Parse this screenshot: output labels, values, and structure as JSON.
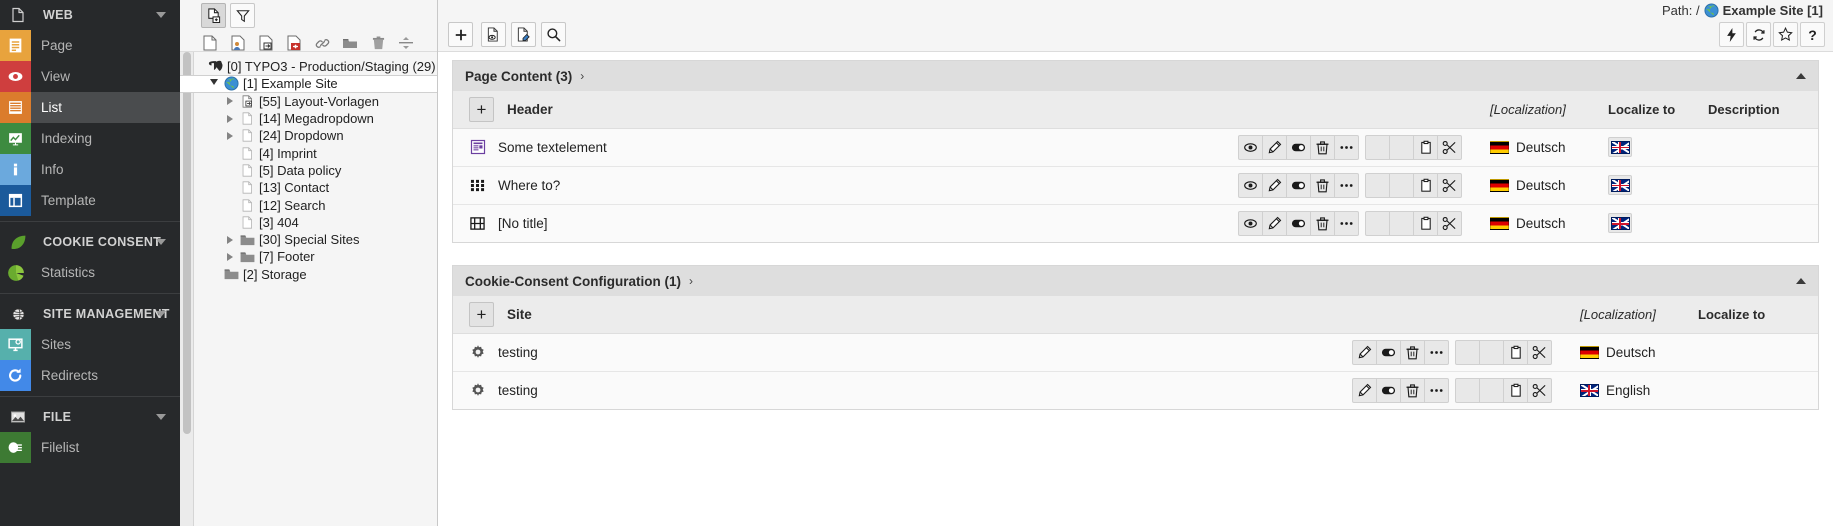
{
  "sidebar": {
    "groups": [
      {
        "name": "WEB",
        "icon": "page-doc-icon",
        "items": [
          {
            "label": "Page",
            "icon": "page-module-icon",
            "color": "#e8a33d",
            "active": false
          },
          {
            "label": "View",
            "icon": "view-eye-icon",
            "color": "#cf3e3e",
            "active": false
          },
          {
            "label": "List",
            "icon": "list-module-icon",
            "color": "#db7c2c",
            "active": true
          },
          {
            "label": "Indexing",
            "icon": "indexing-chart-icon",
            "color": "#3d8b40",
            "active": false
          },
          {
            "label": "Info",
            "icon": "info-module-icon",
            "color": "#6ba9dd",
            "active": false
          },
          {
            "label": "Template",
            "icon": "template-module-icon",
            "color": "#1b5a9b",
            "active": false
          }
        ]
      },
      {
        "name": "COOKIE CONSENT",
        "icon": "leaf-icon",
        "items": [
          {
            "label": "Statistics",
            "icon": "pie-chart-icon",
            "color": "#6aab2f",
            "active": false
          }
        ]
      },
      {
        "name": "SITE MANAGEMENT",
        "icon": "globe-small-icon",
        "items": [
          {
            "label": "Sites",
            "icon": "sites-monitor-icon",
            "color": "#56b0ac",
            "active": false
          },
          {
            "label": "Redirects",
            "icon": "redirect-arrow-icon",
            "color": "#4289e8",
            "active": false
          }
        ]
      },
      {
        "name": "FILE",
        "icon": "image-frame-icon",
        "items": [
          {
            "label": "Filelist",
            "icon": "filelist-icon",
            "color": "#3d7a33",
            "active": false
          }
        ]
      }
    ]
  },
  "tree_toolbar": {
    "primary": [
      {
        "name": "new-page-icon",
        "selected": true
      },
      {
        "name": "filter-funnel-icon",
        "selected": false
      }
    ],
    "drag_icons": [
      "new-page-doc-icon",
      "new-page-user-icon",
      "insert-page-icon",
      "delete-page-icon",
      "link-chain-icon",
      "folder-icon",
      "trash-bin-icon",
      "divider-icon"
    ],
    "refresh": "refresh-tree-icon"
  },
  "tree": {
    "nodes": [
      {
        "label": "[0] TYPO3 - Production/Staging (29)",
        "depth": 0,
        "icon": "typo3-logo-icon",
        "twist": "none",
        "selected": false
      },
      {
        "label": "[1] Example Site",
        "depth": 1,
        "icon": "globe-icon",
        "twist": "open",
        "selected": true
      },
      {
        "label": "[55] Layout-Vorlagen",
        "depth": 2,
        "icon": "page-shortcut-icon",
        "twist": "closed",
        "selected": false
      },
      {
        "label": "[14] Megadropdown",
        "depth": 2,
        "icon": "page-icon",
        "twist": "closed",
        "selected": false
      },
      {
        "label": "[24] Dropdown",
        "depth": 2,
        "icon": "page-icon",
        "twist": "closed",
        "selected": false
      },
      {
        "label": "[4] Imprint",
        "depth": 2,
        "icon": "page-icon",
        "twist": "none",
        "selected": false
      },
      {
        "label": "[5] Data policy",
        "depth": 2,
        "icon": "page-icon",
        "twist": "none",
        "selected": false
      },
      {
        "label": "[13] Contact",
        "depth": 2,
        "icon": "page-icon",
        "twist": "none",
        "selected": false
      },
      {
        "label": "[12] Search",
        "depth": 2,
        "icon": "page-icon",
        "twist": "none",
        "selected": false
      },
      {
        "label": "[3] 404",
        "depth": 2,
        "icon": "page-icon",
        "twist": "none",
        "selected": false
      },
      {
        "label": "[30] Special Sites",
        "depth": 2,
        "icon": "folder-icon",
        "twist": "closed",
        "selected": false
      },
      {
        "label": "[7] Footer",
        "depth": 2,
        "icon": "folder-icon",
        "twist": "closed",
        "selected": false
      },
      {
        "label": "[2] Storage",
        "depth": 1,
        "icon": "folder-icon",
        "twist": "none",
        "selected": false
      }
    ]
  },
  "docheader": {
    "path_label": "Path: /",
    "path_value": "Example Site [1]",
    "path_icon": "globe-icon",
    "left_buttons": [
      {
        "name": "new-record-button",
        "icon": "plus-icon"
      },
      {
        "name": "view-webpage-button",
        "icon": "page-preview-icon"
      },
      {
        "name": "edit-page-button",
        "icon": "page-edit-icon"
      },
      {
        "name": "search-button",
        "icon": "magnifier-icon"
      }
    ],
    "right_buttons": [
      {
        "name": "clear-cache-button",
        "icon": "lightning-icon"
      },
      {
        "name": "reload-button",
        "icon": "refresh-icon"
      },
      {
        "name": "bookmark-button",
        "icon": "star-icon"
      },
      {
        "name": "help-button",
        "icon": "question-icon"
      }
    ]
  },
  "panels": [
    {
      "title": "Page Content (3)",
      "chevron": "›",
      "collapse_icon": "chevron-up-icon",
      "header": {
        "add_label": "+",
        "label": "Header",
        "cols": [
          {
            "text": "[Localization]",
            "style": "italic"
          },
          {
            "text": "Localize to",
            "style": "bold"
          },
          {
            "text": "Description",
            "style": "bold"
          }
        ]
      },
      "rows": [
        {
          "icon": "content-text-icon",
          "title": "Some textelement",
          "actions": [
            "eye-icon",
            "pencil-icon",
            "toggle-icon",
            "trash-icon",
            "more-icon"
          ],
          "clipboard": [
            "",
            "",
            "paste-icon",
            "scissors-icon"
          ],
          "language": "Deutsch",
          "flag": "de",
          "localize_flag": "gb"
        },
        {
          "icon": "content-menu-icon",
          "title": "Where to?",
          "actions": [
            "eye-icon",
            "pencil-icon",
            "toggle-icon",
            "trash-icon",
            "more-icon"
          ],
          "clipboard": [
            "",
            "",
            "paste-icon",
            "scissors-icon"
          ],
          "language": "Deutsch",
          "flag": "de",
          "localize_flag": "gb"
        },
        {
          "icon": "content-media-icon",
          "title": "[No title]",
          "actions": [
            "eye-icon",
            "pencil-icon",
            "toggle-icon",
            "trash-icon",
            "more-icon"
          ],
          "clipboard": [
            "",
            "",
            "paste-icon",
            "scissors-icon"
          ],
          "language": "Deutsch",
          "flag": "de",
          "localize_flag": "gb"
        }
      ]
    },
    {
      "title": "Cookie-Consent Configuration (1)",
      "chevron": "›",
      "collapse_icon": "chevron-up-icon",
      "header": {
        "add_label": "+",
        "label": "Site",
        "cols": [
          {
            "text": "[Localization]",
            "style": "italic"
          },
          {
            "text": "Localize to",
            "style": "bold"
          }
        ]
      },
      "rows": [
        {
          "icon": "gear-icon",
          "title": "testing",
          "actions": [
            "pencil-icon",
            "toggle-icon",
            "trash-icon",
            "more-icon"
          ],
          "clipboard": [
            "",
            "",
            "paste-icon",
            "scissors-icon"
          ],
          "language": "Deutsch",
          "flag": "de",
          "localize_flag": ""
        },
        {
          "icon": "gear-icon",
          "title": "testing",
          "actions": [
            "pencil-icon",
            "toggle-icon",
            "trash-icon",
            "more-icon"
          ],
          "clipboard": [
            "",
            "",
            "paste-icon",
            "scissors-icon"
          ],
          "language": "English",
          "flag": "gb",
          "localize_flag": ""
        }
      ]
    }
  ]
}
